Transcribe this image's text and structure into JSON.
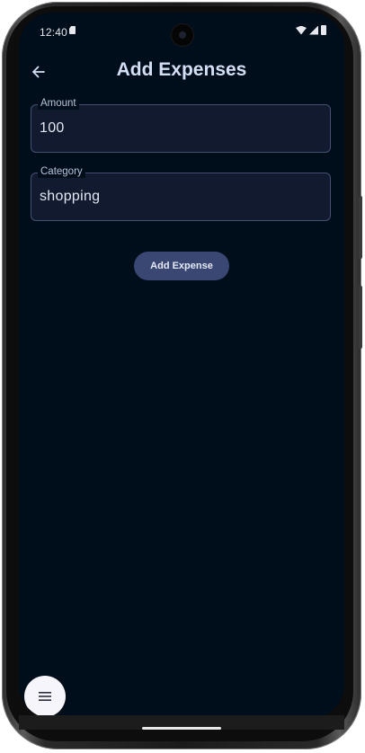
{
  "status_bar": {
    "time": "12:40"
  },
  "header": {
    "title": "Add Expenses",
    "back_icon": "arrow-left-icon"
  },
  "form": {
    "amount": {
      "label": "Amount",
      "value": "100"
    },
    "category": {
      "label": "Category",
      "value": "shopping"
    },
    "submit_label": "Add Expense"
  },
  "fab": {
    "icon": "menu-icon"
  },
  "colors": {
    "background": "#000e1c",
    "title": "#d6def5",
    "button": "#3a4773",
    "field_border": "#45506e",
    "fab": "#f7f5fc"
  }
}
